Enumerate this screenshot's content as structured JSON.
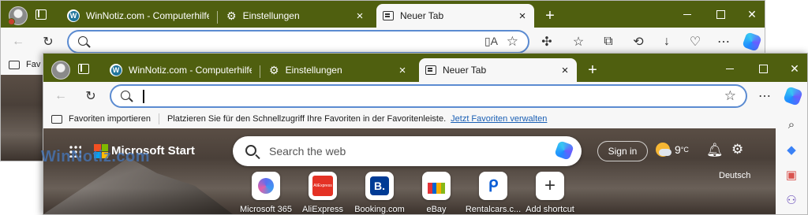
{
  "back_window": {
    "tabs": [
      {
        "title": "WinNotiz.com - Computerhilfe u",
        "icon": "wordpress-icon"
      },
      {
        "title": "Einstellungen",
        "icon": "gear-icon"
      },
      {
        "title": "Neuer Tab",
        "icon": "new-tab-icon",
        "active": true
      }
    ],
    "favorites_fragment": "Fav"
  },
  "front_window": {
    "tabs": [
      {
        "title": "WinNotiz.com - Computerhilfe u",
        "icon": "wordpress-icon"
      },
      {
        "title": "Einstellungen",
        "icon": "gear-icon"
      },
      {
        "title": "Neuer Tab",
        "icon": "new-tab-icon",
        "active": true
      }
    ],
    "address": {
      "value": "",
      "placeholder": ""
    },
    "favorites": {
      "import_label": "Favoriten importieren",
      "hint": "Platzieren Sie für den Schnellzugriff Ihre Favoriten in der Favoritenleiste.",
      "manage_link": "Jetzt Favoriten verwalten"
    },
    "newtab": {
      "brand": "Microsoft Start",
      "search_placeholder": "Search the web",
      "signin_label": "Sign in",
      "weather_temp": "9",
      "weather_unit": "°C",
      "language": "Deutsch",
      "shortcuts": [
        {
          "label": "Microsoft 365",
          "icon": "microsoft365-icon"
        },
        {
          "label": "AliExpress",
          "icon": "aliexpress-icon",
          "tile_text": "AliExpress"
        },
        {
          "label": "Booking.com",
          "icon": "booking-icon",
          "tile_text": "B."
        },
        {
          "label": "eBay",
          "icon": "ebay-icon"
        },
        {
          "label": "Rentalcars.c...",
          "icon": "rentalcars-icon"
        },
        {
          "label": "Add shortcut",
          "icon": "plus-icon"
        }
      ]
    }
  },
  "watermark": "WinNotiz.com",
  "colors": {
    "titlebar": "#4f5f0f",
    "address_border": "#5b8bd1",
    "link": "#1a5fb4",
    "ms_logo": [
      "#f25022",
      "#7fba00",
      "#00a4ef",
      "#ffb900"
    ]
  }
}
